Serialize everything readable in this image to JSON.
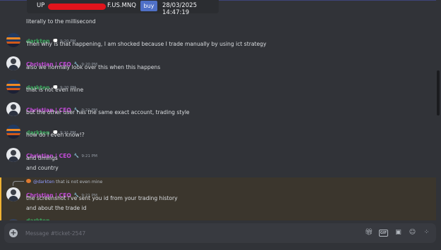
{
  "embed": {
    "account_prefix": "UP",
    "symbol": "F.US.MNQ",
    "side": "buy",
    "datetime": "28/03/2025 14:47:19"
  },
  "messages": [
    {
      "id": "m0",
      "type": "cont",
      "text": "literally to the millisecond"
    },
    {
      "id": "m1",
      "type": "group",
      "author": "darkten",
      "author_color": "#3ba55c",
      "badge": "💭",
      "time": "9:20 PM",
      "lines": [
        "Then why is that happening, I am shocked because I trade manually by using ict strategy"
      ]
    },
    {
      "id": "m2",
      "type": "group",
      "author": "Christian | CEO",
      "author_color": "#c34bd8",
      "badge": "🔧",
      "time": "9:20 PM",
      "lines": [
        "also we normaly look over this when this happens"
      ]
    },
    {
      "id": "m3",
      "type": "group",
      "author": "darkten",
      "author_color": "#3ba55c",
      "badge": "💭",
      "time": "9:20 PM",
      "lines": [
        "that is not even mine"
      ]
    },
    {
      "id": "m4",
      "type": "group",
      "author": "Christian | CEO",
      "author_color": "#c34bd8",
      "badge": "🔧",
      "time": "9:21 PM",
      "lines": [
        "but the other user has the same exact account, trading style"
      ]
    },
    {
      "id": "m5",
      "type": "group",
      "author": "darkten",
      "author_color": "#3ba55c",
      "badge": "💭",
      "time": "9:21 PM",
      "lines": [
        "how do I even know!?"
      ]
    },
    {
      "id": "m6",
      "type": "group",
      "author": "Christian | CEO",
      "author_color": "#c34bd8",
      "badge": "🔧",
      "time": "9:21 PM",
      "lines": [
        "and timings",
        "and country"
      ]
    },
    {
      "id": "m7",
      "type": "reply",
      "reply_to": "@darkten",
      "reply_text": "that is not even mine",
      "author": "Christian | CEO",
      "author_color": "#c34bd8",
      "badge": "🔧",
      "time": "9:21 PM",
      "lines": [
        "the screenshot i've sent you id from your trading history",
        "and about the trade id"
      ]
    },
    {
      "id": "m8",
      "type": "partial",
      "author": "darkten"
    }
  ],
  "composer": {
    "placeholder": "Message #ticket-2547",
    "gif_label": "GIF"
  },
  "colors": {
    "background": "#313338",
    "mention_highlight": "#3b362d",
    "mention_bar": "#f0b232"
  }
}
